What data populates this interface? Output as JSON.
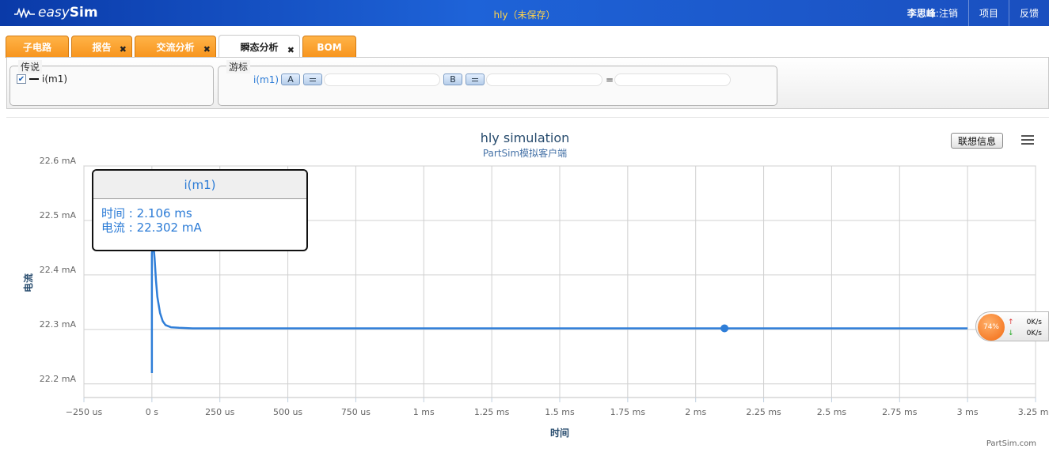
{
  "header": {
    "logo_prefix": "easy",
    "logo_suffix": "Sim",
    "doc_title": "hly（未保存）",
    "user_name": "李思峰",
    "logout": "注销",
    "project": "项目",
    "feedback": "反馈"
  },
  "tabs": [
    {
      "label": "子电路",
      "closable": false
    },
    {
      "label": "报告",
      "closable": true
    },
    {
      "label": "交流分析",
      "closable": true
    },
    {
      "label": "瞬态分析",
      "closable": true,
      "active": true
    },
    {
      "label": "BOM",
      "closable": false
    }
  ],
  "legend_box": {
    "title": "传说",
    "item_label": "i(m1)",
    "checked": true
  },
  "cursor_box": {
    "title": "游标",
    "signal": "i(m1)",
    "btn_a": "A",
    "btn_b": "B",
    "eq": "="
  },
  "chart_toolbar": {
    "assoc_label": "联想信息",
    "menu_icon": "hamburger-icon"
  },
  "chart_data": {
    "type": "line",
    "title": "hly simulation",
    "subtitle": "PartSim模拟客户端",
    "xlabel": "时间",
    "ylabel": "电流",
    "x_unit": "ms",
    "xlim": [
      -0.25,
      3.25
    ],
    "ylim": [
      22.175,
      22.6
    ],
    "x_ticks": [
      -0.25,
      0,
      0.25,
      0.5,
      0.75,
      1,
      1.25,
      1.5,
      1.75,
      2,
      2.25,
      2.5,
      2.75,
      3,
      3.25
    ],
    "x_tick_labels": [
      "−250 us",
      "0 s",
      "250 us",
      "500 us",
      "750 us",
      "1 ms",
      "1.25 ms",
      "1.5 ms",
      "1.75 ms",
      "2 ms",
      "2.25 ms",
      "2.5 ms",
      "2.75 ms",
      "3 ms",
      "3.25 ms"
    ],
    "y_ticks": [
      22.2,
      22.3,
      22.4,
      22.5,
      22.6
    ],
    "y_tick_labels": [
      "22.2 mA",
      "22.3 mA",
      "22.4 mA",
      "22.5 mA",
      "22.6 mA"
    ],
    "grid": true,
    "series": [
      {
        "name": "i(m1)",
        "color": "#2f7ed8",
        "x": [
          0,
          0,
          0.005,
          0.01,
          0.015,
          0.02,
          0.03,
          0.04,
          0.05,
          0.07,
          0.1,
          0.15,
          0.2,
          0.5,
          1.0,
          2.0,
          3.0
        ],
        "y": [
          22.22,
          22.44,
          22.46,
          22.43,
          22.39,
          22.36,
          22.33,
          22.315,
          22.308,
          22.304,
          22.303,
          22.302,
          22.302,
          22.302,
          22.302,
          22.302,
          22.302
        ]
      }
    ],
    "highlight_point": {
      "x": 2.106,
      "y": 22.302
    }
  },
  "tooltip": {
    "series": "i(m1)",
    "line1": "时间 : 2.106 ms",
    "line2": "电流 : 22.302 mA"
  },
  "credit": "PartSim.com",
  "net_widget": {
    "percent": "74%",
    "up_rate": "0K/s",
    "down_rate": "0K/s"
  }
}
